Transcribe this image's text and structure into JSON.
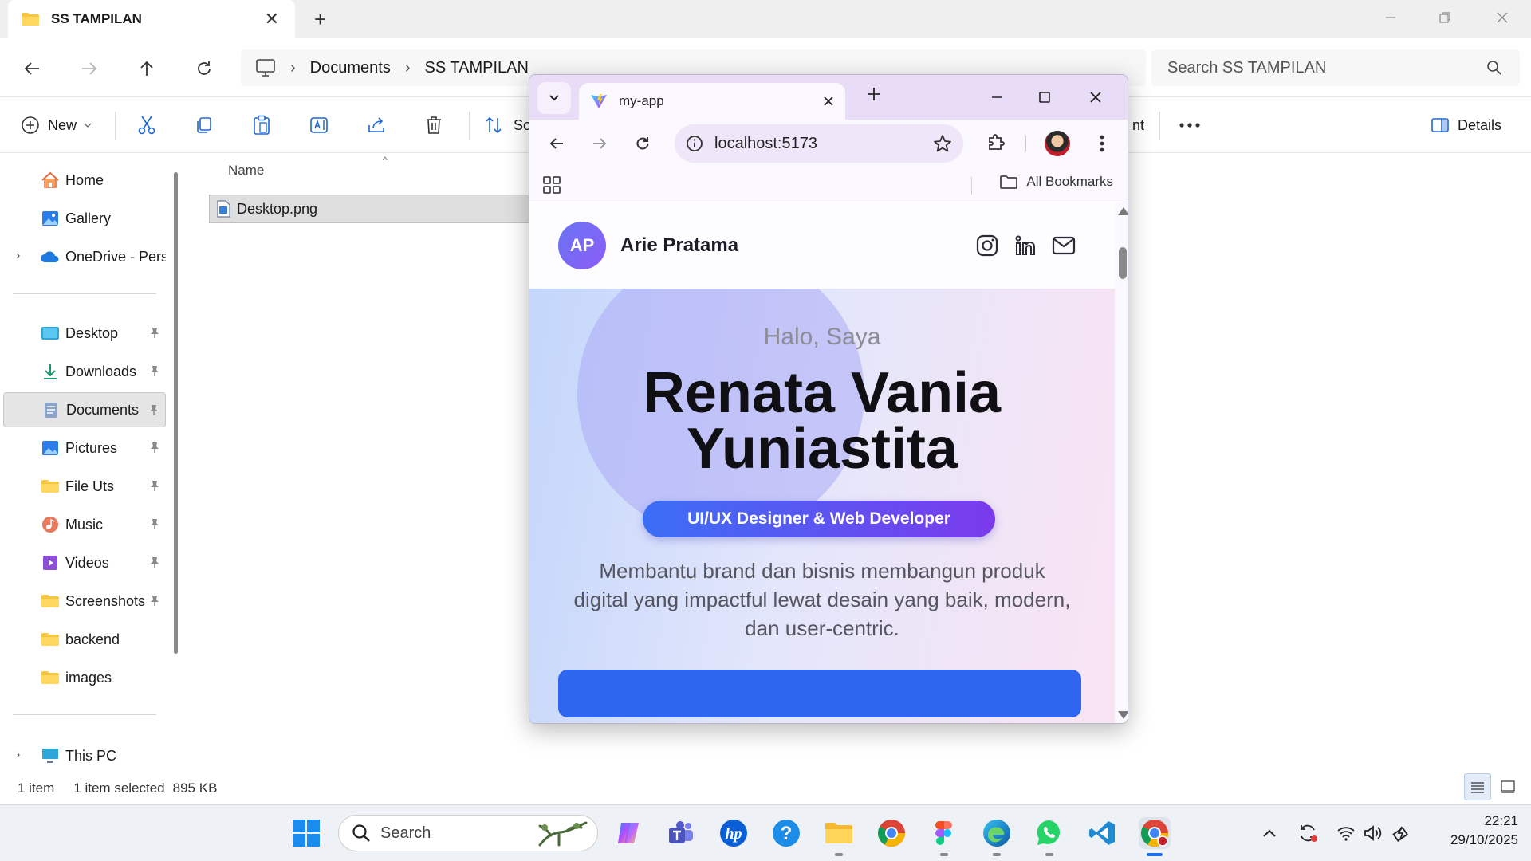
{
  "explorer": {
    "tab_title": "SS TAMPILAN",
    "breadcrumb": [
      "Documents",
      "SS TAMPILAN"
    ],
    "search_placeholder": "Search SS TAMPILAN",
    "toolbar": {
      "new_label": "New",
      "sort_label_partial": "So",
      "hidden_label_partial": "nt",
      "details_label": "Details"
    },
    "sidebar": {
      "top_items": [
        {
          "label": "Home",
          "icon": "home-icon"
        },
        {
          "label": "Gallery",
          "icon": "gallery-icon"
        },
        {
          "label": "OneDrive - Perso",
          "icon": "onedrive-icon"
        }
      ],
      "quick_access": [
        {
          "label": "Desktop",
          "icon": "desktop-folder-icon"
        },
        {
          "label": "Downloads",
          "icon": "downloads-icon"
        },
        {
          "label": "Documents",
          "icon": "documents-icon"
        },
        {
          "label": "Pictures",
          "icon": "pictures-icon"
        },
        {
          "label": "File Uts",
          "icon": "folder-icon"
        },
        {
          "label": "Music",
          "icon": "music-icon"
        },
        {
          "label": "Videos",
          "icon": "videos-icon"
        },
        {
          "label": "Screenshots",
          "icon": "folder-icon"
        },
        {
          "label": "backend",
          "icon": "folder-icon"
        },
        {
          "label": "images",
          "icon": "folder-icon"
        }
      ],
      "this_pc": "This PC",
      "selected": "Documents"
    },
    "content": {
      "column_name": "Name",
      "files": [
        {
          "name": "Desktop.png",
          "selected": true
        }
      ]
    },
    "status": {
      "count": "1 item",
      "selection": "1 item selected",
      "size": "895 KB"
    }
  },
  "browser": {
    "tab_title": "my-app",
    "url": "localhost:5173",
    "bookmarks_label": "All Bookmarks",
    "accent": "#e8dcf6"
  },
  "site": {
    "logo_initials": "AP",
    "brand_name": "Arie Pratama",
    "greeting": "Halo, Saya",
    "name_line1": "Renata Vania",
    "name_line2": "Yuniastita",
    "role": "UI/UX Designer & Web Developer",
    "description": "Membantu brand dan bisnis membangun produk digital yang impactful lewat desain yang baik, modern, dan user-centric.",
    "primary_color": "#2f66f0",
    "gradient_colors": [
      "#3b6ff5",
      "#7c3aed"
    ]
  },
  "taskbar": {
    "search_label": "Search",
    "time": "22:21",
    "date": "29/10/2025"
  }
}
